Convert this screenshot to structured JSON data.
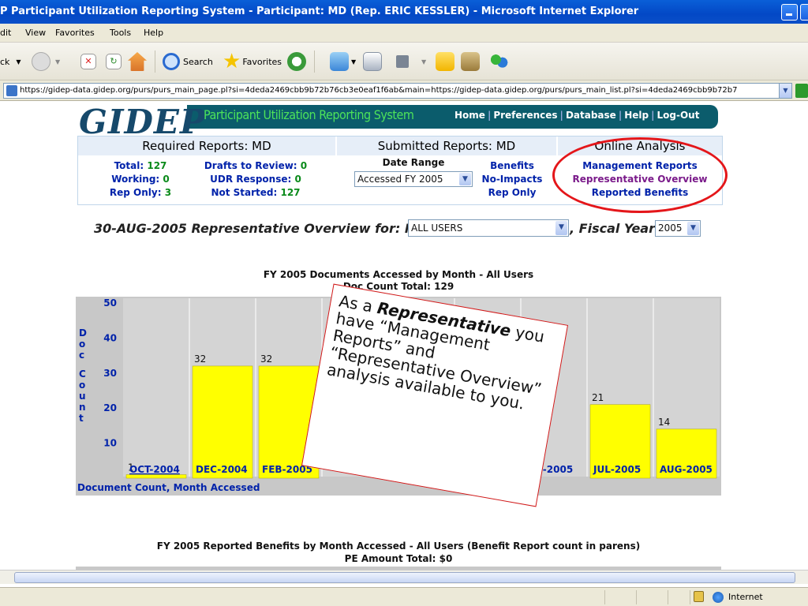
{
  "window": {
    "title": "P Participant Utilization Reporting System - Participant: MD (Rep. ERIC KESSLER) - Microsoft Internet Explorer"
  },
  "menu": [
    "dit",
    "View",
    "Favorites",
    "Tools",
    "Help"
  ],
  "toolbar": {
    "back": "ck",
    "search": "Search",
    "favorites": "Favorites"
  },
  "address": {
    "url": "https://gidep-data.gidep.org/purs/purs_main_page.pl?si=4deda2469cbb9b72b76cb3e0eaf1f6ab&main=https://gidep-data.gidep.org/purs/purs_main_list.pl?si=4deda2469cbb9b72b7"
  },
  "header": {
    "logo": "GIDEP",
    "system_name": "Participant Utilization Reporting System",
    "nav": [
      "Home",
      "Preferences",
      "Database",
      "Help",
      "Log-Out"
    ]
  },
  "panel": {
    "required": {
      "heading": "Required Reports: MD",
      "total_label": "Total:",
      "total": "127",
      "working_label": "Working:",
      "working": "0",
      "rep_only_label": "Rep Only:",
      "rep_only": "3",
      "drafts_label": "Drafts to Review:",
      "drafts": "0",
      "udr_label": "UDR Response:",
      "udr": "0",
      "not_started_label": "Not Started:",
      "not_started": "127"
    },
    "submitted": {
      "heading": "Submitted Reports: MD",
      "date_range_label": "Date Range",
      "date_range_value": "Accessed FY 2005",
      "links": [
        "Benefits",
        "No-Impacts",
        "Rep Only"
      ]
    },
    "online": {
      "heading": "Online Analysis",
      "links": [
        "Management Reports",
        "Representative Overview",
        "Reported Benefits"
      ]
    }
  },
  "report": {
    "title_prefix": "30-AUG-2005 Representative Overview for: MD",
    "users_value": "ALL USERS",
    "fiscal_year_label": ", Fiscal Year:",
    "fiscal_year_value": "2005"
  },
  "chart_data": {
    "type": "bar",
    "title": "FY 2005 Documents Accessed by Month - All Users",
    "subtitle": "Doc Count Total: 129",
    "ylabel": "Doc Count",
    "xlabel": "Document Count, Month Accessed",
    "yticks": [
      10,
      20,
      30,
      40,
      50
    ],
    "categories": [
      "OCT-2004",
      "DEC-2004",
      "FEB-2005",
      "JUN-2005",
      "JUL-2005",
      "AUG-2005"
    ],
    "values": [
      1,
      32,
      32,
      null,
      21,
      14
    ],
    "value_labels": [
      "1",
      "32",
      "32",
      "",
      "21",
      "14"
    ],
    "category_labels_shown": [
      "OCT-2004",
      "DEC-2004",
      "FEB-2005",
      "UN-2005",
      "JUL-2005",
      "AUG-2005"
    ],
    "bar_color": "#ffff00",
    "plot_bg": "#d4d4d4"
  },
  "callout": {
    "line1_pre": "As a ",
    "line1_bold": "Representative",
    "text": "you have “Management Reports” and “Representative Overview” analysis available to you."
  },
  "benefits": {
    "title": "FY 2005 Reported Benefits by Month Accessed - All Users (Benefit Report count in parens)",
    "subtitle": "PE Amount Total: $0"
  },
  "status": {
    "zone": "Internet"
  },
  "colors": {
    "accent_red": "#e4161a",
    "link_blue": "#0022aa",
    "visited_purple": "#7a1a8a",
    "green": "#0a8a1a"
  }
}
